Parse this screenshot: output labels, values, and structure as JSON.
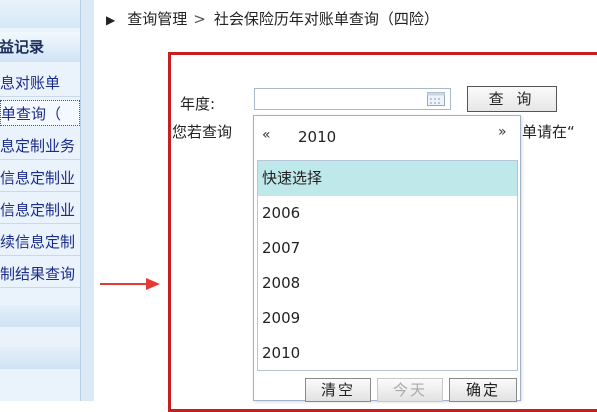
{
  "sidebar": {
    "header": "益记录",
    "items": [
      {
        "label": "息对账单"
      },
      {
        "label": "单查询（"
      },
      {
        "label": "息定制业务"
      },
      {
        "label": "信息定制业"
      },
      {
        "label": "信息定制业"
      },
      {
        "label": "续信息定制"
      },
      {
        "label": "制结果查询"
      }
    ]
  },
  "breadcrumb": {
    "parent": "查询管理",
    "separator": ">",
    "current": "社会保险历年对账单查询（四险）"
  },
  "form": {
    "year_label": "年度:",
    "year_value": "",
    "query_button": "查 询",
    "hint_left": "您若查询",
    "hint_right": "单请在“"
  },
  "picker": {
    "prev_label": "«",
    "year": "2010",
    "next_label": "»",
    "options": [
      "快速选择",
      "2006",
      "2007",
      "2008",
      "2009",
      "2010"
    ],
    "selected_index": 0,
    "buttons": {
      "clear": "清空",
      "today": "今天",
      "confirm": "确定"
    }
  },
  "colors": {
    "panel_border": "#c81e1e",
    "annotation_arrow": "#e53935",
    "selected_option": "#bfe8ea"
  }
}
